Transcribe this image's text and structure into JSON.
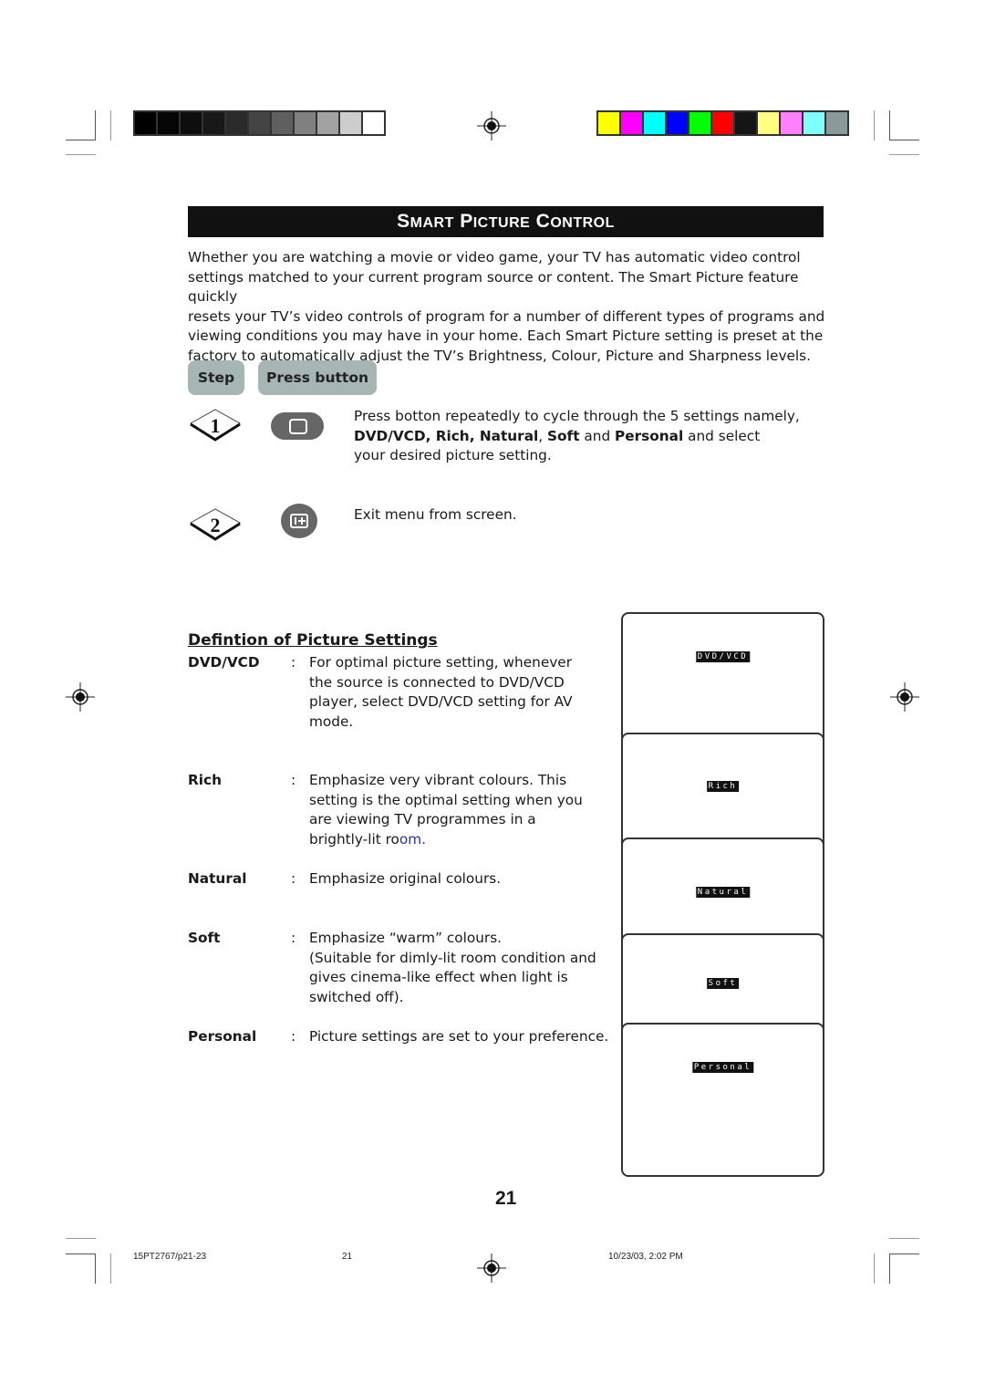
{
  "print_marks": {
    "grayscale_swatches": [
      "#000000",
      "#050505",
      "#0e0e0e",
      "#181818",
      "#2a2a2a",
      "#444444",
      "#5f5f5f",
      "#808080",
      "#a2a2a2",
      "#cdcdcd",
      "#ffffff"
    ],
    "color_swatches": [
      "#ffff00",
      "#ff00ff",
      "#00ffff",
      "#0000ff",
      "#00ff00",
      "#ff0000",
      "#151515",
      "#ffff80",
      "#ff80ff",
      "#80ffff",
      "#8a9a9a"
    ]
  },
  "header": {
    "title_words": [
      {
        "first": "S",
        "rest": "MART"
      },
      {
        "first": "P",
        "rest": "ICTURE"
      },
      {
        "first": "C",
        "rest": "ONTROL"
      }
    ]
  },
  "intro": {
    "lines": [
      "Whether you are watching a movie or video game, your TV has automatic video control",
      "settings matched to your current program source or content. The Smart Picture feature quickly",
      "resets your TV’s video controls of program for a number of different types of programs and",
      "viewing conditions you may have in your home. Each Smart Picture setting is preset at the",
      "factory to automatically adjust the TV’s Brightness, Colour, Picture and Sharpness levels."
    ]
  },
  "steps_header": {
    "step_label": "Step",
    "press_label": "Press button"
  },
  "steps": [
    {
      "number": "1",
      "button_icon": "smart-picture-button-icon",
      "line1": "Press botton repeatedly to cycle through the 5 settings namely,",
      "line2_parts": [
        {
          "text": "DVD/VCD, Rich, Natural",
          "bold": true
        },
        {
          "text": ", ",
          "bold": false
        },
        {
          "text": "Soft",
          "bold": true
        },
        {
          "text": " and ",
          "bold": false
        },
        {
          "text": "Personal",
          "bold": true
        },
        {
          "text": " and select",
          "bold": false
        }
      ],
      "line3": "your desired picture setting."
    },
    {
      "number": "2",
      "button_icon": "info-plus-button-icon",
      "line1": "Exit menu from screen."
    }
  ],
  "definitions": {
    "title": "Defintion of Picture Settings",
    "items": [
      {
        "term": "DVD/VCD",
        "colon": ":",
        "lines": [
          "For optimal picture setting, whenever",
          "the source is connected to DVD/VCD",
          "player, select DVD/VCD setting for AV",
          "mode."
        ]
      },
      {
        "term": "Rich",
        "colon": ":",
        "lines": [
          "Emphasize very vibrant colours. This",
          "setting is the optimal setting when you",
          "are viewing TV programmes in a"
        ],
        "last_line_plain": "brightly-lit ro",
        "last_line_blue": "om."
      },
      {
        "term": "Natural",
        "colon": ":",
        "lines": [
          "Emphasize original colours."
        ]
      },
      {
        "term": "Soft",
        "colon": ":",
        "lines": [
          "Emphasize “warm” colours.",
          "(Suitable for dimly-lit room condition and",
          "gives cinema-like effect when light is",
          "switched off)."
        ]
      },
      {
        "term": "Personal",
        "colon": ":",
        "lines": [
          "Picture settings are set to your preference."
        ]
      }
    ]
  },
  "tv_screens": [
    {
      "label": "DVD/VCD"
    },
    {
      "label": "Rich"
    },
    {
      "label": "Natural"
    },
    {
      "label": "Soft"
    },
    {
      "label": "Personal"
    }
  ],
  "page_number": "21",
  "footer": {
    "file": "15PT2767/p21-23",
    "page": "21",
    "timestamp": "10/23/03, 2:02 PM"
  }
}
